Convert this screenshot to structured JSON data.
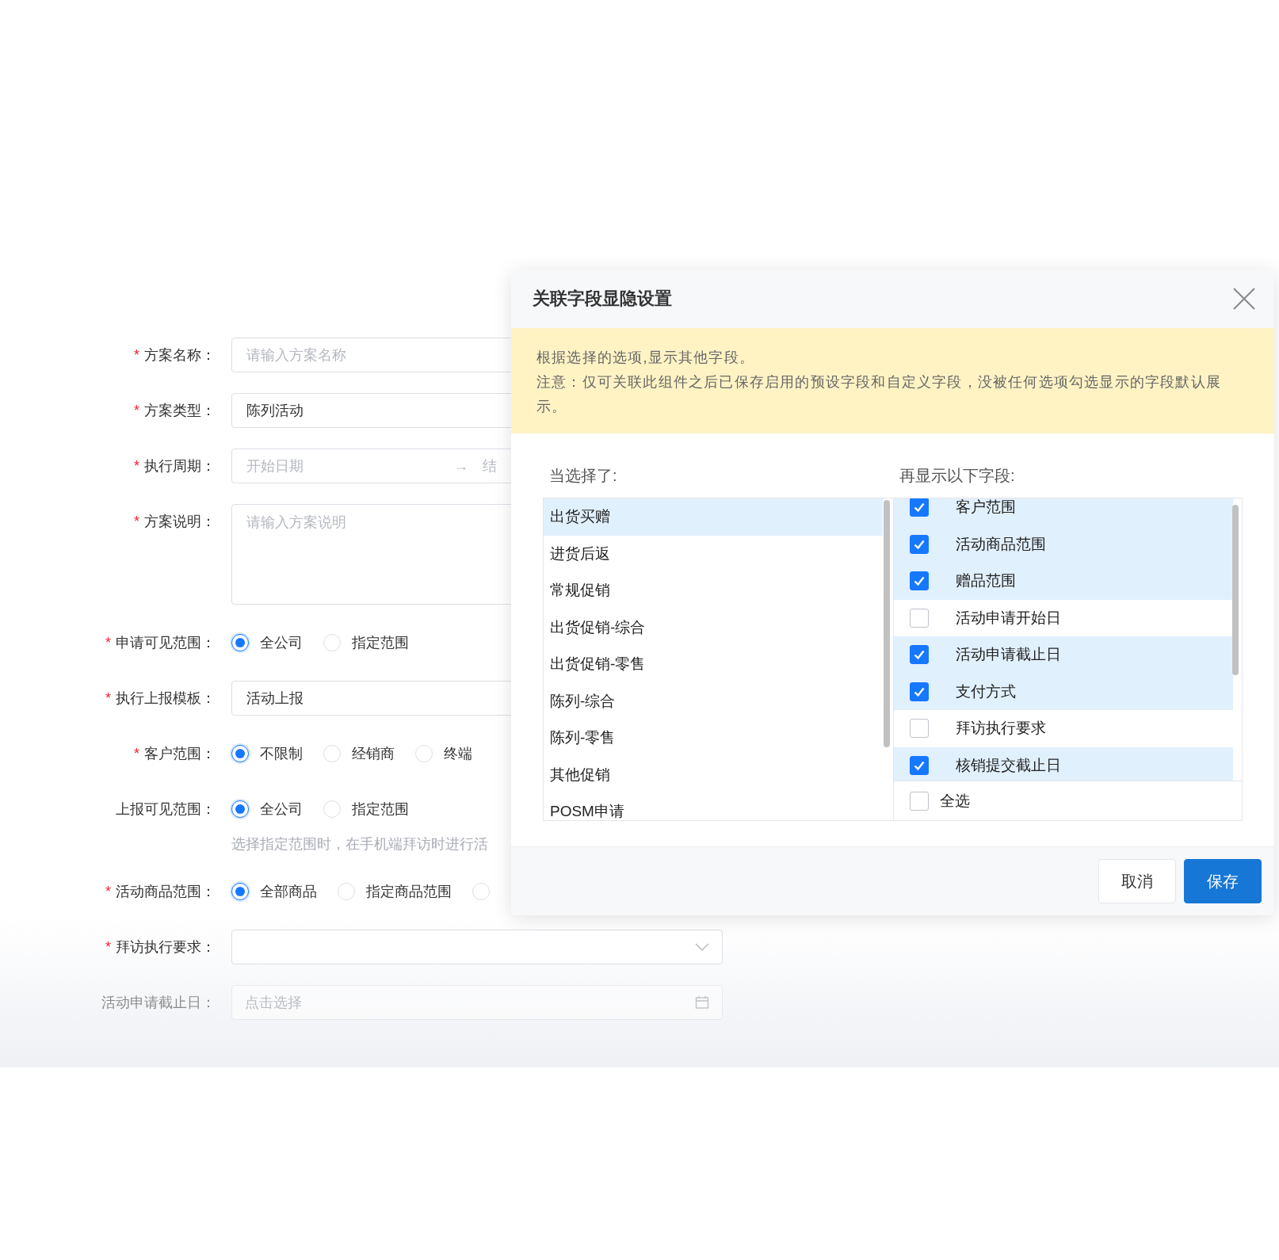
{
  "form": {
    "fields": [
      {
        "kind": "input",
        "mark": "*",
        "label": "方案名称：",
        "placeholder": "请输入方案名称"
      },
      {
        "kind": "input",
        "mark": "*",
        "label": "方案类型：",
        "value": "陈列活动"
      },
      {
        "kind": "range",
        "mark": "*",
        "label": "执行周期：",
        "start_placeholder": "开始日期",
        "separator": "→",
        "end_placeholder": "结"
      },
      {
        "kind": "textarea",
        "mark": "*",
        "label": "方案说明：",
        "placeholder": "请输入方案说明"
      },
      {
        "kind": "radio",
        "mark": "*",
        "label": "申请可见范围：",
        "options": [
          {
            "label": "全公司",
            "selected": true
          },
          {
            "label": "指定范围",
            "selected": false
          }
        ]
      },
      {
        "kind": "input",
        "mark": "*",
        "label": "执行上报模板：",
        "value": "活动上报"
      },
      {
        "kind": "radio",
        "mark": "*",
        "label": "客户范围：",
        "options": [
          {
            "label": "不限制",
            "selected": true
          },
          {
            "label": "经销商",
            "selected": false
          },
          {
            "label": "终端",
            "selected": false
          }
        ]
      },
      {
        "kind": "radio",
        "label": "上报可见范围：",
        "options": [
          {
            "label": "全公司",
            "selected": true
          },
          {
            "label": "指定范围",
            "selected": false
          }
        ],
        "hint": "选择指定范围时，在手机端拜访时进行活"
      },
      {
        "kind": "radio",
        "mark": "*",
        "label": "活动商品范围：",
        "options": [
          {
            "label": "全部商品",
            "selected": true
          },
          {
            "label": "指定商品范围",
            "selected": false
          },
          {
            "selected": false
          }
        ]
      },
      {
        "kind": "select",
        "mark": "*",
        "label": "拜访执行要求："
      },
      {
        "kind": "date",
        "label": "活动申请截止日：",
        "placeholder": "点击选择",
        "faded": true
      }
    ]
  },
  "dialog": {
    "title": "关联字段显隐设置",
    "notice": [
      "根据选择的选项,显示其他字段。",
      "注意：仅可关联此组件之后已保存启用的预设字段和自定义字段，没被任何选项勾选显示的字段默认展示。"
    ],
    "left_heading": "当选择了:",
    "right_heading": "再显示以下字段:",
    "options": [
      {
        "label": "出货买赠",
        "selected": true
      },
      {
        "label": "进货后返",
        "selected": false
      },
      {
        "label": "常规促销",
        "selected": false
      },
      {
        "label": "出货促销-综合",
        "selected": false
      },
      {
        "label": "出货促销-零售",
        "selected": false
      },
      {
        "label": "陈列-综合",
        "selected": false
      },
      {
        "label": "陈列-零售",
        "selected": false
      },
      {
        "label": "其他促销",
        "selected": false
      },
      {
        "label": "POSM申请",
        "selected": false
      }
    ],
    "fields": [
      {
        "label": "客户范围",
        "checked": true
      },
      {
        "label": "活动商品范围",
        "checked": true
      },
      {
        "label": "赠品范围",
        "checked": true
      },
      {
        "label": "活动申请开始日",
        "checked": false
      },
      {
        "label": "活动申请截止日",
        "checked": true
      },
      {
        "label": "支付方式",
        "checked": true
      },
      {
        "label": "拜访执行要求",
        "checked": false
      },
      {
        "label": "核销提交截止日",
        "checked": true
      }
    ],
    "select_all": {
      "label": "全选",
      "checked": false
    },
    "buttons": [
      {
        "label": "取消",
        "kind": "default"
      },
      {
        "label": "保存",
        "kind": "primary"
      }
    ]
  }
}
